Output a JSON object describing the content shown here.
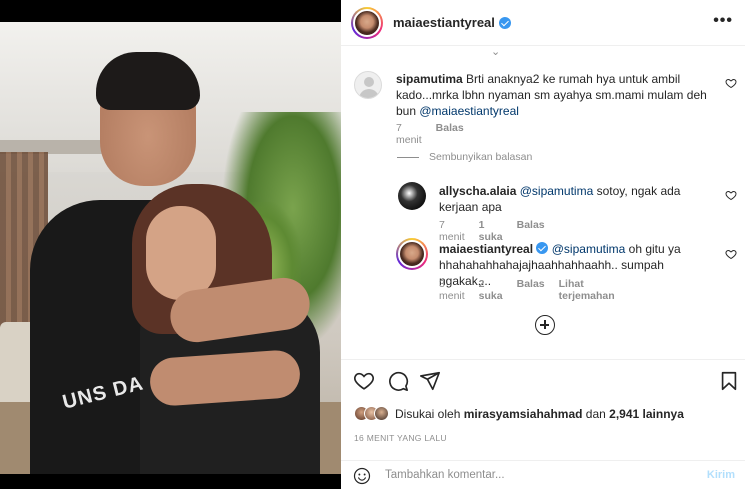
{
  "post": {
    "author": "maiaestiantyreal",
    "more_icon": "more-horizontal-icon"
  },
  "photo": {
    "print_text": "UNS DA"
  },
  "comments": [
    {
      "username": "sipamutima",
      "text": "Brti anaknya2 ke rumah hya untuk ambil kado...mrka lbhn nyaman sm ayahya sm.mami mulam deh bun",
      "mention": "@maiaestiantyreal",
      "time": "7 menit",
      "reply_label": "Balas"
    }
  ],
  "hide_replies": "Sembunyikan balasan",
  "replies": [
    {
      "username": "allyscha.alaia",
      "mention": "@sipamutima",
      "text": "sotoy, ngak ada kerjaan apa",
      "time": "7 menit",
      "likes": "1 suka",
      "reply_label": "Balas"
    },
    {
      "username": "maiaestiantyreal",
      "mention": "@sipamutima",
      "text": "oh gitu ya hhahahahhahajajhaahhahhaahh.. sumpah ngakak....",
      "time": "3 menit",
      "likes": "2 suka",
      "reply_label": "Balas",
      "translate_label": "Lihat terjemahan"
    }
  ],
  "likes": {
    "prefix": "Disukai oleh",
    "user": "mirasyamsiahahmad",
    "joiner": "dan",
    "others": "2,941 lainnya"
  },
  "timestamp": "16 MENIT YANG LALU",
  "add_comment": {
    "placeholder": "Tambahkan komentar...",
    "post_label": "Kirim"
  },
  "colors": {
    "verified": "#3897f0",
    "mention": "#00376b",
    "secondary_text": "#8e8e8e",
    "post_button_disabled": "#b2dffc"
  }
}
